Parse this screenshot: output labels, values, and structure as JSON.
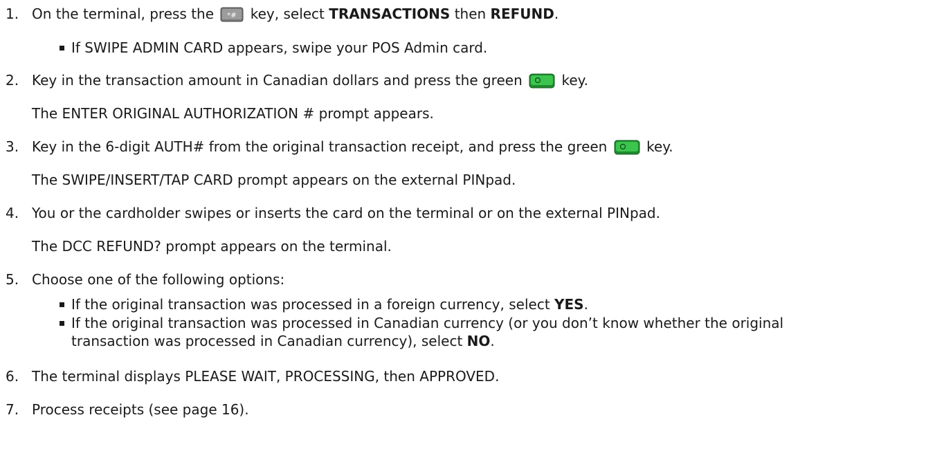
{
  "steps": [
    {
      "num": "1.",
      "pre": "On the terminal, press the",
      "mid": "key, select",
      "bold1": "TRANSACTIONS",
      "then": "then",
      "bold2": "REFUND",
      "post": ".",
      "key_icon": "function-key-icon",
      "bullet": "If SWIPE ADMIN CARD appears, swipe your POS Admin card."
    },
    {
      "num": "2.",
      "pre": "Key in the transaction amount in Canadian dollars and press the green",
      "post": "key.",
      "key_icon": "green-enter-key-icon",
      "note": "The ENTER ORIGINAL AUTHORIZATION # prompt appears."
    },
    {
      "num": "3.",
      "pre": "Key in the 6-digit AUTH# from the original transaction receipt, and press the green",
      "post": "key.",
      "key_icon": "green-enter-key-icon",
      "note": "The SWIPE/INSERT/TAP CARD prompt appears on the external PINpad."
    },
    {
      "num": "4.",
      "text": "You or the cardholder swipes or inserts the card on the terminal or on the external PINpad.",
      "note": "The DCC REFUND? prompt appears on the terminal."
    },
    {
      "num": "5.",
      "text": "Choose one of the following options:",
      "bullets": [
        {
          "pre": "If the original transaction was processed in a foreign currency, select",
          "bold": "YES",
          "post": "."
        },
        {
          "pre": "If the original transaction was processed in Canadian currency (or you don’t know whether the original",
          "cont": "transaction was processed in Canadian currency), select",
          "bold": "NO",
          "post": "."
        }
      ]
    },
    {
      "num": "6.",
      "text": "The terminal displays PLEASE WAIT, PROCESSING, then APPROVED."
    },
    {
      "num": "7.",
      "text": "Process receipts (see page 16)."
    }
  ],
  "colors": {
    "text": "#1a1a1a",
    "key_green": "#2fae3f",
    "key_gray": "#8a8a8a"
  }
}
